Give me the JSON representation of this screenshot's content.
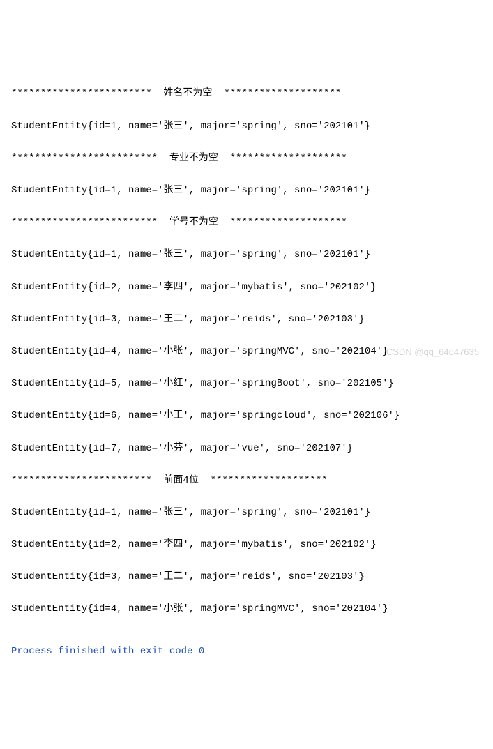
{
  "console": {
    "lines": [
      "************************  姓名不为空  ********************",
      "StudentEntity{id=1, name='张三', major='spring', sno='202101'}",
      "*************************  专业不为空  ********************",
      "StudentEntity{id=1, name='张三', major='spring', sno='202101'}",
      "*************************  学号不为空  ********************",
      "StudentEntity{id=1, name='张三', major='spring', sno='202101'}",
      "StudentEntity{id=2, name='李四', major='mybatis', sno='202102'}",
      "StudentEntity{id=3, name='王二', major='reids', sno='202103'}",
      "StudentEntity{id=4, name='小张', major='springMVC', sno='202104'}",
      "StudentEntity{id=5, name='小红', major='springBoot', sno='202105'}",
      "StudentEntity{id=6, name='小王', major='springcloud', sno='202106'}",
      "StudentEntity{id=7, name='小芬', major='vue', sno='202107'}",
      "************************  前面4位  ********************",
      "StudentEntity{id=1, name='张三', major='spring', sno='202101'}",
      "StudentEntity{id=2, name='李四', major='mybatis', sno='202102'}",
      "StudentEntity{id=3, name='王二', major='reids', sno='202103'}",
      "StudentEntity{id=4, name='小张', major='springMVC', sno='202104'}"
    ],
    "exit_message": "Process finished with exit code 0"
  },
  "watermark": "CSDN @qq_64647635"
}
